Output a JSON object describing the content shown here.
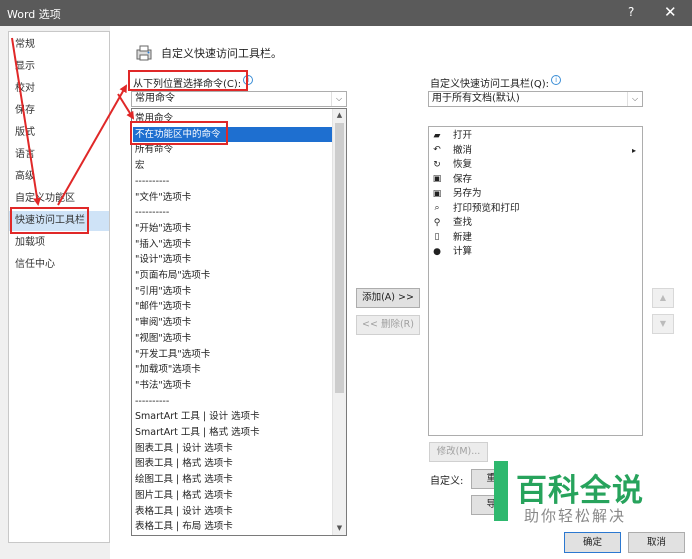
{
  "window": {
    "title": "Word 选项",
    "help": "?",
    "close": "✕"
  },
  "nav": {
    "items": [
      {
        "label": "常规"
      },
      {
        "label": "显示"
      },
      {
        "label": "校对"
      },
      {
        "label": "保存"
      },
      {
        "label": "版式"
      },
      {
        "label": "语言"
      },
      {
        "label": "高级"
      },
      {
        "label": "自定义功能区"
      },
      {
        "label": "快速访问工具栏"
      },
      {
        "label": "加载项"
      },
      {
        "label": "信任中心"
      }
    ],
    "selected_index": 8
  },
  "main": {
    "section_title": "自定义快速访问工具栏。",
    "choose_from_label": "从下列位置选择命令(C):",
    "choose_from_value": "常用命令",
    "customize_label": "自定义快速访问工具栏(Q):",
    "customize_value": "用于所有文档(默认)",
    "info_icon": "i",
    "arrow_glyph": "⌵",
    "dropdown": {
      "up_glyph": "▲",
      "down_glyph": "▼",
      "items": [
        {
          "label": "常用命令"
        },
        {
          "label": "不在功能区中的命令",
          "selected": true
        },
        {
          "label": "所有命令"
        },
        {
          "label": "宏"
        },
        {
          "label": "----------"
        },
        {
          "label": "\"文件\"选项卡"
        },
        {
          "label": "----------"
        },
        {
          "label": "\"开始\"选项卡"
        },
        {
          "label": "\"插入\"选项卡"
        },
        {
          "label": "\"设计\"选项卡"
        },
        {
          "label": "\"页面布局\"选项卡"
        },
        {
          "label": "\"引用\"选项卡"
        },
        {
          "label": "\"邮件\"选项卡"
        },
        {
          "label": "\"审阅\"选项卡"
        },
        {
          "label": "\"视图\"选项卡"
        },
        {
          "label": "\"开发工具\"选项卡"
        },
        {
          "label": "\"加载项\"选项卡"
        },
        {
          "label": "\"书法\"选项卡"
        },
        {
          "label": "----------"
        },
        {
          "label": "SmartArt 工具 | 设计 选项卡"
        },
        {
          "label": "SmartArt 工具 | 格式 选项卡"
        },
        {
          "label": "图表工具 | 设计 选项卡"
        },
        {
          "label": "图表工具 | 格式 选项卡"
        },
        {
          "label": "绘图工具 | 格式 选项卡"
        },
        {
          "label": "图片工具 | 格式 选项卡"
        },
        {
          "label": "表格工具 | 设计 选项卡"
        },
        {
          "label": "表格工具 | 布局 选项卡"
        }
      ]
    },
    "qat_items": [
      {
        "label": "打开",
        "icon": "open-folder-icon",
        "glyph": "▰"
      },
      {
        "label": "撤消",
        "icon": "undo-icon",
        "glyph": "↶",
        "submenu": "▸"
      },
      {
        "label": "恢复",
        "icon": "redo-icon",
        "glyph": "↻"
      },
      {
        "label": "保存",
        "icon": "save-icon",
        "glyph": "▣"
      },
      {
        "label": "另存为",
        "icon": "save-as-icon",
        "glyph": "▣"
      },
      {
        "label": "打印预览和打印",
        "icon": "print-preview-icon",
        "glyph": "⌕"
      },
      {
        "label": "查找",
        "icon": "find-icon",
        "glyph": "⚲"
      },
      {
        "label": "新建",
        "icon": "new-document-icon",
        "glyph": "▯"
      },
      {
        "label": "计算",
        "icon": "calculate-icon",
        "glyph": "●"
      }
    ],
    "add_button": "添加(A) >>",
    "remove_button": "<< 删除(R)",
    "move_up": "▲",
    "move_down": "▼",
    "modify_button": "修改(M)...",
    "customizations_label": "自定义:",
    "reset_button": "重置",
    "import_export_button": "导入"
  },
  "footer": {
    "ok": "确定",
    "cancel": "取消"
  },
  "watermark": {
    "title": "百科全说",
    "subtitle": "助你轻松解决"
  },
  "colors": {
    "highlight": "#e02828",
    "selection": "#1e6fd0",
    "titlebar": "#5a5a5a"
  }
}
